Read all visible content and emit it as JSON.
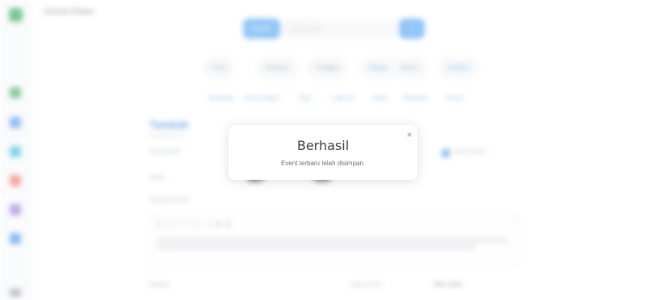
{
  "app": {
    "title": "Entrolio Rekam",
    "search": {
      "scope_label": "Event",
      "placeholder": "Cari event...",
      "button_label": "⌕"
    },
    "filters": [
      "Kota",
      "Kategori",
      "Tanggal",
      "Harga",
      "Status",
      "Urutkan"
    ],
    "nav_links": [
      "Beranda",
      "Event Saya",
      "Tiket",
      "Laporan",
      "Akun",
      "Bantuan",
      "Keluar"
    ],
    "form": {
      "title": "Tambah",
      "subtitle": "Isi detail event",
      "name_label": "Nama Event",
      "online_label": "Event online",
      "publish_label": "Status",
      "desc_label": "Deskripsi Event",
      "toolbar": "B I U ≡ ≡ ⇤ ⇥ ⌘ ⊞",
      "category_label": "Kategori",
      "location_label": "Lokasi Event",
      "location_value": "Pilih Lokasi"
    }
  },
  "modal": {
    "title": "Berhasil",
    "message": "Event terbaru telah disimpan.",
    "close_label": "×"
  },
  "colors": {
    "accent": "#58a6f2",
    "link": "#5b9fe6",
    "modal_bg": "#ffffff",
    "title_text": "#3a3d42"
  }
}
